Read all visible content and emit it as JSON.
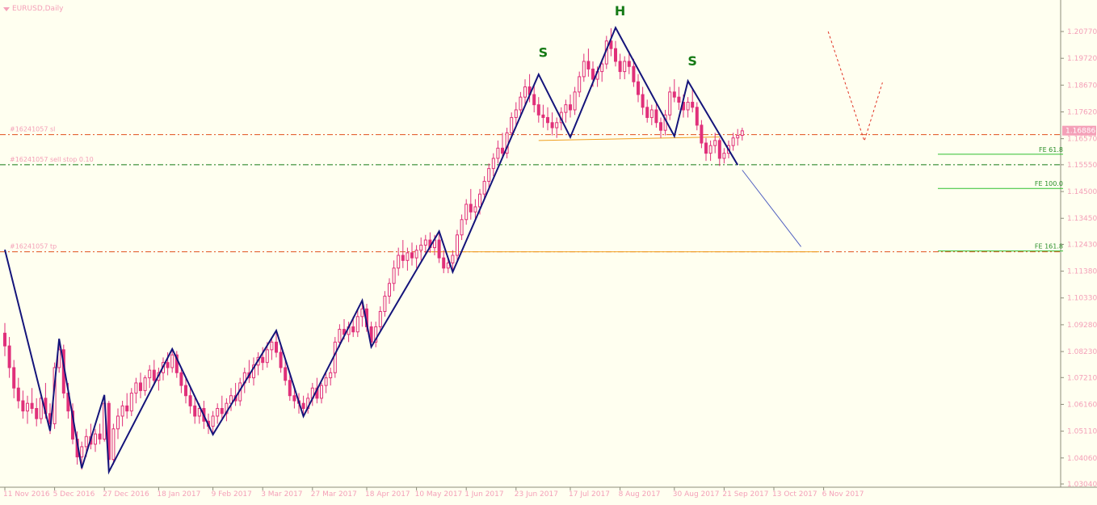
{
  "chart_data": {
    "type": "candlestick",
    "title": "EURUSD,Daily",
    "current_price": "1.16886",
    "y_ticks": [
      "1.20770",
      "1.19720",
      "1.18670",
      "1.17620",
      "1.16570",
      "1.15550",
      "1.14500",
      "1.13450",
      "1.12430",
      "1.11380",
      "1.10330",
      "1.09280",
      "1.08230",
      "1.07210",
      "1.06160",
      "1.05110",
      "1.04060",
      "1.03040"
    ],
    "x_ticks": [
      "11 Nov 2016",
      "5 Dec 2016",
      "27 Dec 2016",
      "18 Jan 2017",
      "9 Feb 2017",
      "3 Mar 2017",
      "27 Mar 2017",
      "18 Apr 2017",
      "10 May 2017",
      "1 Jun 2017",
      "23 Jun 2017",
      "17 Jul 2017",
      "8 Aug 2017",
      "30 Aug 2017",
      "21 Sep 2017",
      "13 Oct 2017",
      "6 Nov 2017"
    ],
    "ylim": [
      1.0304,
      1.2077
    ],
    "order_lines": [
      {
        "label": "#16241057 sl",
        "price": 1.1673,
        "color": "#e0501c"
      },
      {
        "label": "#16241057 sell stop 0.10",
        "price": 1.1555,
        "color": "#157a15"
      },
      {
        "label": "#16241057 tp",
        "price": 1.1214,
        "color": "#e0501c"
      }
    ],
    "fe_levels": [
      {
        "label": "FE 61.8",
        "price": 1.1596
      },
      {
        "label": "FE 100.0",
        "price": 1.1462
      },
      {
        "label": "FE 161.8",
        "price": 1.1217
      }
    ],
    "pattern_labels": [
      {
        "text": "S",
        "bar": 119,
        "price": 1.1978
      },
      {
        "text": "H",
        "bar": 136,
        "price": 1.214
      },
      {
        "text": "S",
        "bar": 152,
        "price": 1.1944
      }
    ],
    "neckline": [
      {
        "bar": 118,
        "price": 1.165
      },
      {
        "bar": 158,
        "price": 1.1664
      }
    ],
    "tp_line": [
      {
        "bar": 94,
        "price": 1.1214
      },
      {
        "bar": 180,
        "price": 1.1214
      }
    ],
    "zigzag": [
      {
        "bar": 0,
        "price": 1.1222
      },
      {
        "bar": 10,
        "price": 1.0512
      },
      {
        "bar": 12,
        "price": 1.0873
      },
      {
        "bar": 17,
        "price": 1.0366
      },
      {
        "bar": 22,
        "price": 1.0653
      },
      {
        "bar": 23,
        "price": 1.0352
      },
      {
        "bar": 37,
        "price": 1.0833
      },
      {
        "bar": 46,
        "price": 1.0498
      },
      {
        "bar": 60,
        "price": 1.0905
      },
      {
        "bar": 66,
        "price": 1.0569
      },
      {
        "bar": 79,
        "price": 1.1023
      },
      {
        "bar": 81,
        "price": 1.0841
      },
      {
        "bar": 96,
        "price": 1.1294
      },
      {
        "bar": 99,
        "price": 1.1135
      },
      {
        "bar": 118,
        "price": 1.1909
      },
      {
        "bar": 125,
        "price": 1.1663
      },
      {
        "bar": 135,
        "price": 1.2092
      },
      {
        "bar": 148,
        "price": 1.1667
      },
      {
        "bar": 151,
        "price": 1.1883
      },
      {
        "bar": 162,
        "price": 1.1554
      }
    ],
    "projection_line": [
      {
        "bar": 163,
        "price": 1.1534
      },
      {
        "bar": 176,
        "price": 1.1234
      }
    ],
    "forecast_dashed": [
      {
        "bar": 182,
        "price": 1.2077
      },
      {
        "bar": 190,
        "price": 1.1648
      },
      {
        "bar": 194,
        "price": 1.1877
      }
    ],
    "candles": [
      {
        "o": 1.0895,
        "h": 1.0935,
        "l": 1.0805,
        "c": 1.0845
      },
      {
        "o": 1.0845,
        "h": 1.088,
        "l": 1.072,
        "c": 1.076
      },
      {
        "o": 1.076,
        "h": 1.079,
        "l": 1.064,
        "c": 1.068
      },
      {
        "o": 1.068,
        "h": 1.072,
        "l": 1.06,
        "c": 1.063
      },
      {
        "o": 1.063,
        "h": 1.067,
        "l": 1.056,
        "c": 1.059
      },
      {
        "o": 1.059,
        "h": 1.065,
        "l": 1.054,
        "c": 1.062
      },
      {
        "o": 1.062,
        "h": 1.068,
        "l": 1.058,
        "c": 1.06
      },
      {
        "o": 1.06,
        "h": 1.064,
        "l": 1.053,
        "c": 1.056
      },
      {
        "o": 1.056,
        "h": 1.066,
        "l": 1.054,
        "c": 1.064
      },
      {
        "o": 1.064,
        "h": 1.07,
        "l": 1.056,
        "c": 1.058
      },
      {
        "o": 1.058,
        "h": 1.062,
        "l": 1.05,
        "c": 1.054
      },
      {
        "o": 1.054,
        "h": 1.078,
        "l": 1.052,
        "c": 1.076
      },
      {
        "o": 1.076,
        "h": 1.087,
        "l": 1.074,
        "c": 1.083
      },
      {
        "o": 1.083,
        "h": 1.085,
        "l": 1.064,
        "c": 1.066
      },
      {
        "o": 1.066,
        "h": 1.07,
        "l": 1.056,
        "c": 1.059
      },
      {
        "o": 1.059,
        "h": 1.062,
        "l": 1.046,
        "c": 1.048
      },
      {
        "o": 1.048,
        "h": 1.051,
        "l": 1.038,
        "c": 1.041
      },
      {
        "o": 1.041,
        "h": 1.047,
        "l": 1.036,
        "c": 1.045
      },
      {
        "o": 1.045,
        "h": 1.052,
        "l": 1.041,
        "c": 1.049
      },
      {
        "o": 1.049,
        "h": 1.054,
        "l": 1.044,
        "c": 1.046
      },
      {
        "o": 1.046,
        "h": 1.052,
        "l": 1.043,
        "c": 1.05
      },
      {
        "o": 1.05,
        "h": 1.054,
        "l": 1.046,
        "c": 1.048
      },
      {
        "o": 1.048,
        "h": 1.065,
        "l": 1.047,
        "c": 1.062
      },
      {
        "o": 1.062,
        "h": 1.063,
        "l": 1.035,
        "c": 1.04
      },
      {
        "o": 1.04,
        "h": 1.054,
        "l": 1.038,
        "c": 1.052
      },
      {
        "o": 1.052,
        "h": 1.06,
        "l": 1.048,
        "c": 1.057
      },
      {
        "o": 1.057,
        "h": 1.063,
        "l": 1.053,
        "c": 1.061
      },
      {
        "o": 1.061,
        "h": 1.066,
        "l": 1.056,
        "c": 1.059
      },
      {
        "o": 1.059,
        "h": 1.068,
        "l": 1.057,
        "c": 1.066
      },
      {
        "o": 1.066,
        "h": 1.072,
        "l": 1.062,
        "c": 1.07
      },
      {
        "o": 1.07,
        "h": 1.074,
        "l": 1.064,
        "c": 1.067
      },
      {
        "o": 1.067,
        "h": 1.073,
        "l": 1.065,
        "c": 1.072
      },
      {
        "o": 1.072,
        "h": 1.077,
        "l": 1.068,
        "c": 1.075
      },
      {
        "o": 1.075,
        "h": 1.079,
        "l": 1.069,
        "c": 1.071
      },
      {
        "o": 1.071,
        "h": 1.076,
        "l": 1.067,
        "c": 1.074
      },
      {
        "o": 1.074,
        "h": 1.08,
        "l": 1.071,
        "c": 1.078
      },
      {
        "o": 1.078,
        "h": 1.082,
        "l": 1.073,
        "c": 1.076
      },
      {
        "o": 1.076,
        "h": 1.0835,
        "l": 1.074,
        "c": 1.081
      },
      {
        "o": 1.081,
        "h": 1.0825,
        "l": 1.072,
        "c": 1.074
      },
      {
        "o": 1.074,
        "h": 1.076,
        "l": 1.066,
        "c": 1.069
      },
      {
        "o": 1.069,
        "h": 1.072,
        "l": 1.062,
        "c": 1.065
      },
      {
        "o": 1.065,
        "h": 1.068,
        "l": 1.058,
        "c": 1.061
      },
      {
        "o": 1.061,
        "h": 1.064,
        "l": 1.054,
        "c": 1.057
      },
      {
        "o": 1.057,
        "h": 1.062,
        "l": 1.054,
        "c": 1.06
      },
      {
        "o": 1.06,
        "h": 1.063,
        "l": 1.052,
        "c": 1.055
      },
      {
        "o": 1.055,
        "h": 1.058,
        "l": 1.05,
        "c": 1.053
      },
      {
        "o": 1.053,
        "h": 1.059,
        "l": 1.05,
        "c": 1.057
      },
      {
        "o": 1.057,
        "h": 1.062,
        "l": 1.054,
        "c": 1.06
      },
      {
        "o": 1.06,
        "h": 1.065,
        "l": 1.056,
        "c": 1.058
      },
      {
        "o": 1.058,
        "h": 1.064,
        "l": 1.055,
        "c": 1.062
      },
      {
        "o": 1.062,
        "h": 1.068,
        "l": 1.059,
        "c": 1.065
      },
      {
        "o": 1.065,
        "h": 1.07,
        "l": 1.061,
        "c": 1.063
      },
      {
        "o": 1.063,
        "h": 1.072,
        "l": 1.061,
        "c": 1.07
      },
      {
        "o": 1.07,
        "h": 1.076,
        "l": 1.066,
        "c": 1.074
      },
      {
        "o": 1.074,
        "h": 1.079,
        "l": 1.07,
        "c": 1.072
      },
      {
        "o": 1.072,
        "h": 1.08,
        "l": 1.069,
        "c": 1.077
      },
      {
        "o": 1.077,
        "h": 1.082,
        "l": 1.073,
        "c": 1.08
      },
      {
        "o": 1.08,
        "h": 1.084,
        "l": 1.075,
        "c": 1.078
      },
      {
        "o": 1.078,
        "h": 1.086,
        "l": 1.076,
        "c": 1.083
      },
      {
        "o": 1.083,
        "h": 1.088,
        "l": 1.079,
        "c": 1.086
      },
      {
        "o": 1.086,
        "h": 1.0905,
        "l": 1.08,
        "c": 1.082
      },
      {
        "o": 1.082,
        "h": 1.085,
        "l": 1.074,
        "c": 1.076
      },
      {
        "o": 1.076,
        "h": 1.079,
        "l": 1.069,
        "c": 1.071
      },
      {
        "o": 1.071,
        "h": 1.073,
        "l": 1.063,
        "c": 1.065
      },
      {
        "o": 1.065,
        "h": 1.068,
        "l": 1.06,
        "c": 1.063
      },
      {
        "o": 1.063,
        "h": 1.066,
        "l": 1.058,
        "c": 1.062
      },
      {
        "o": 1.062,
        "h": 1.065,
        "l": 1.057,
        "c": 1.06
      },
      {
        "o": 1.06,
        "h": 1.066,
        "l": 1.058,
        "c": 1.064
      },
      {
        "o": 1.064,
        "h": 1.07,
        "l": 1.061,
        "c": 1.068
      },
      {
        "o": 1.068,
        "h": 1.072,
        "l": 1.062,
        "c": 1.064
      },
      {
        "o": 1.064,
        "h": 1.07,
        "l": 1.062,
        "c": 1.069
      },
      {
        "o": 1.069,
        "h": 1.074,
        "l": 1.066,
        "c": 1.072
      },
      {
        "o": 1.072,
        "h": 1.076,
        "l": 1.069,
        "c": 1.074
      },
      {
        "o": 1.074,
        "h": 1.088,
        "l": 1.072,
        "c": 1.086
      },
      {
        "o": 1.086,
        "h": 1.093,
        "l": 1.084,
        "c": 1.091
      },
      {
        "o": 1.091,
        "h": 1.095,
        "l": 1.087,
        "c": 1.089
      },
      {
        "o": 1.089,
        "h": 1.094,
        "l": 1.086,
        "c": 1.092
      },
      {
        "o": 1.092,
        "h": 1.096,
        "l": 1.088,
        "c": 1.09
      },
      {
        "o": 1.09,
        "h": 1.099,
        "l": 1.088,
        "c": 1.096
      },
      {
        "o": 1.096,
        "h": 1.102,
        "l": 1.092,
        "c": 1.099
      },
      {
        "o": 1.099,
        "h": 1.101,
        "l": 1.09,
        "c": 1.092
      },
      {
        "o": 1.092,
        "h": 1.094,
        "l": 1.084,
        "c": 1.086
      },
      {
        "o": 1.086,
        "h": 1.094,
        "l": 1.084,
        "c": 1.092
      },
      {
        "o": 1.092,
        "h": 1.1,
        "l": 1.09,
        "c": 1.098
      },
      {
        "o": 1.098,
        "h": 1.106,
        "l": 1.096,
        "c": 1.104
      },
      {
        "o": 1.104,
        "h": 1.111,
        "l": 1.101,
        "c": 1.109
      },
      {
        "o": 1.109,
        "h": 1.118,
        "l": 1.106,
        "c": 1.115
      },
      {
        "o": 1.115,
        "h": 1.123,
        "l": 1.112,
        "c": 1.12
      },
      {
        "o": 1.12,
        "h": 1.126,
        "l": 1.115,
        "c": 1.118
      },
      {
        "o": 1.118,
        "h": 1.123,
        "l": 1.114,
        "c": 1.121
      },
      {
        "o": 1.121,
        "h": 1.125,
        "l": 1.116,
        "c": 1.119
      },
      {
        "o": 1.119,
        "h": 1.124,
        "l": 1.115,
        "c": 1.122
      },
      {
        "o": 1.122,
        "h": 1.127,
        "l": 1.118,
        "c": 1.124
      },
      {
        "o": 1.124,
        "h": 1.128,
        "l": 1.12,
        "c": 1.126
      },
      {
        "o": 1.126,
        "h": 1.129,
        "l": 1.121,
        "c": 1.123
      },
      {
        "o": 1.123,
        "h": 1.128,
        "l": 1.12,
        "c": 1.126
      },
      {
        "o": 1.126,
        "h": 1.129,
        "l": 1.117,
        "c": 1.119
      },
      {
        "o": 1.119,
        "h": 1.122,
        "l": 1.113,
        "c": 1.115
      },
      {
        "o": 1.115,
        "h": 1.119,
        "l": 1.113,
        "c": 1.117
      },
      {
        "o": 1.117,
        "h": 1.122,
        "l": 1.114,
        "c": 1.12
      },
      {
        "o": 1.12,
        "h": 1.13,
        "l": 1.118,
        "c": 1.128
      },
      {
        "o": 1.128,
        "h": 1.136,
        "l": 1.126,
        "c": 1.134
      },
      {
        "o": 1.134,
        "h": 1.142,
        "l": 1.132,
        "c": 1.14
      },
      {
        "o": 1.14,
        "h": 1.146,
        "l": 1.134,
        "c": 1.137
      },
      {
        "o": 1.137,
        "h": 1.142,
        "l": 1.134,
        "c": 1.139
      },
      {
        "o": 1.139,
        "h": 1.146,
        "l": 1.136,
        "c": 1.144
      },
      {
        "o": 1.144,
        "h": 1.151,
        "l": 1.142,
        "c": 1.149
      },
      {
        "o": 1.149,
        "h": 1.156,
        "l": 1.146,
        "c": 1.154
      },
      {
        "o": 1.154,
        "h": 1.16,
        "l": 1.151,
        "c": 1.158
      },
      {
        "o": 1.158,
        "h": 1.165,
        "l": 1.156,
        "c": 1.162
      },
      {
        "o": 1.162,
        "h": 1.168,
        "l": 1.158,
        "c": 1.16
      },
      {
        "o": 1.16,
        "h": 1.17,
        "l": 1.158,
        "c": 1.168
      },
      {
        "o": 1.168,
        "h": 1.176,
        "l": 1.166,
        "c": 1.174
      },
      {
        "o": 1.174,
        "h": 1.18,
        "l": 1.171,
        "c": 1.177
      },
      {
        "o": 1.177,
        "h": 1.184,
        "l": 1.174,
        "c": 1.182
      },
      {
        "o": 1.182,
        "h": 1.189,
        "l": 1.179,
        "c": 1.186
      },
      {
        "o": 1.186,
        "h": 1.191,
        "l": 1.18,
        "c": 1.183
      },
      {
        "o": 1.183,
        "h": 1.187,
        "l": 1.176,
        "c": 1.179
      },
      {
        "o": 1.179,
        "h": 1.182,
        "l": 1.172,
        "c": 1.175
      },
      {
        "o": 1.175,
        "h": 1.179,
        "l": 1.17,
        "c": 1.174
      },
      {
        "o": 1.174,
        "h": 1.178,
        "l": 1.169,
        "c": 1.172
      },
      {
        "o": 1.172,
        "h": 1.176,
        "l": 1.167,
        "c": 1.17
      },
      {
        "o": 1.17,
        "h": 1.174,
        "l": 1.166,
        "c": 1.172
      },
      {
        "o": 1.172,
        "h": 1.178,
        "l": 1.169,
        "c": 1.176
      },
      {
        "o": 1.176,
        "h": 1.181,
        "l": 1.172,
        "c": 1.179
      },
      {
        "o": 1.179,
        "h": 1.183,
        "l": 1.174,
        "c": 1.177
      },
      {
        "o": 1.177,
        "h": 1.186,
        "l": 1.175,
        "c": 1.184
      },
      {
        "o": 1.184,
        "h": 1.192,
        "l": 1.182,
        "c": 1.19
      },
      {
        "o": 1.19,
        "h": 1.199,
        "l": 1.188,
        "c": 1.196
      },
      {
        "o": 1.196,
        "h": 1.201,
        "l": 1.19,
        "c": 1.193
      },
      {
        "o": 1.193,
        "h": 1.196,
        "l": 1.186,
        "c": 1.189
      },
      {
        "o": 1.189,
        "h": 1.194,
        "l": 1.186,
        "c": 1.192
      },
      {
        "o": 1.192,
        "h": 1.197,
        "l": 1.188,
        "c": 1.195
      },
      {
        "o": 1.195,
        "h": 1.206,
        "l": 1.193,
        "c": 1.204
      },
      {
        "o": 1.204,
        "h": 1.209,
        "l": 1.198,
        "c": 1.201
      },
      {
        "o": 1.201,
        "h": 1.204,
        "l": 1.194,
        "c": 1.196
      },
      {
        "o": 1.196,
        "h": 1.199,
        "l": 1.189,
        "c": 1.192
      },
      {
        "o": 1.192,
        "h": 1.198,
        "l": 1.189,
        "c": 1.196
      },
      {
        "o": 1.196,
        "h": 1.2,
        "l": 1.191,
        "c": 1.194
      },
      {
        "o": 1.194,
        "h": 1.197,
        "l": 1.186,
        "c": 1.188
      },
      {
        "o": 1.188,
        "h": 1.191,
        "l": 1.18,
        "c": 1.183
      },
      {
        "o": 1.183,
        "h": 1.186,
        "l": 1.175,
        "c": 1.178
      },
      {
        "o": 1.178,
        "h": 1.181,
        "l": 1.172,
        "c": 1.174
      },
      {
        "o": 1.174,
        "h": 1.179,
        "l": 1.171,
        "c": 1.177
      },
      {
        "o": 1.177,
        "h": 1.18,
        "l": 1.17,
        "c": 1.172
      },
      {
        "o": 1.172,
        "h": 1.174,
        "l": 1.166,
        "c": 1.169
      },
      {
        "o": 1.169,
        "h": 1.177,
        "l": 1.167,
        "c": 1.175
      },
      {
        "o": 1.175,
        "h": 1.186,
        "l": 1.173,
        "c": 1.184
      },
      {
        "o": 1.184,
        "h": 1.189,
        "l": 1.18,
        "c": 1.182
      },
      {
        "o": 1.182,
        "h": 1.186,
        "l": 1.177,
        "c": 1.18
      },
      {
        "o": 1.18,
        "h": 1.183,
        "l": 1.174,
        "c": 1.177
      },
      {
        "o": 1.177,
        "h": 1.182,
        "l": 1.174,
        "c": 1.18
      },
      {
        "o": 1.18,
        "h": 1.185,
        "l": 1.176,
        "c": 1.178
      },
      {
        "o": 1.178,
        "h": 1.18,
        "l": 1.169,
        "c": 1.171
      },
      {
        "o": 1.171,
        "h": 1.173,
        "l": 1.162,
        "c": 1.164
      },
      {
        "o": 1.164,
        "h": 1.166,
        "l": 1.157,
        "c": 1.16
      },
      {
        "o": 1.16,
        "h": 1.165,
        "l": 1.157,
        "c": 1.163
      },
      {
        "o": 1.163,
        "h": 1.168,
        "l": 1.16,
        "c": 1.165
      },
      {
        "o": 1.165,
        "h": 1.166,
        "l": 1.155,
        "c": 1.158
      },
      {
        "o": 1.158,
        "h": 1.162,
        "l": 1.156,
        "c": 1.16
      },
      {
        "o": 1.16,
        "h": 1.165,
        "l": 1.158,
        "c": 1.163
      },
      {
        "o": 1.163,
        "h": 1.168,
        "l": 1.161,
        "c": 1.166
      },
      {
        "o": 1.166,
        "h": 1.1695,
        "l": 1.163,
        "c": 1.167
      },
      {
        "o": 1.167,
        "h": 1.17,
        "l": 1.165,
        "c": 1.1688
      }
    ]
  }
}
